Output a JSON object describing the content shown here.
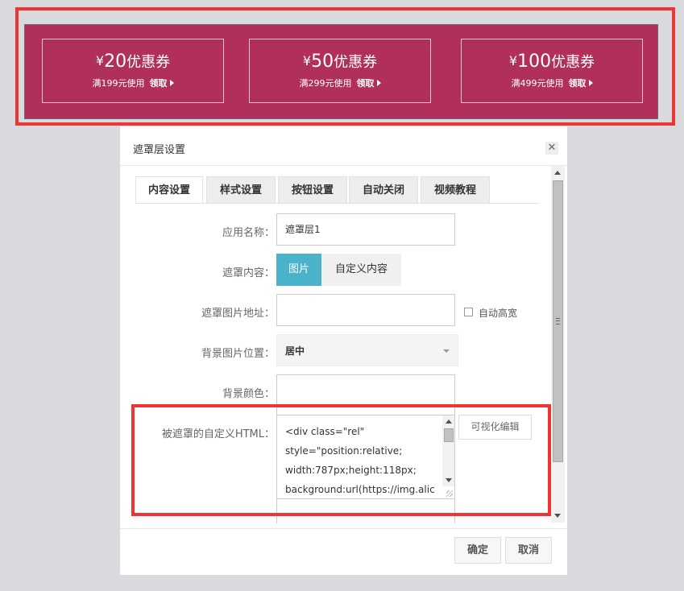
{
  "banner": {
    "coupons": [
      {
        "currency": "¥",
        "amount": "20",
        "title": "优惠券",
        "condition": "满199元使用",
        "claim": "领取"
      },
      {
        "currency": "¥",
        "amount": "50",
        "title": "优惠券",
        "condition": "满299元使用",
        "claim": "领取"
      },
      {
        "currency": "¥",
        "amount": "100",
        "title": "优惠券",
        "condition": "满499元使用",
        "claim": "领取"
      }
    ],
    "background_color": "#b0305a"
  },
  "dialog": {
    "title": "遮罩层设置",
    "close_symbol": "✕",
    "tabs": [
      {
        "label": "内容设置",
        "active": true
      },
      {
        "label": "样式设置",
        "active": false
      },
      {
        "label": "按钮设置",
        "active": false
      },
      {
        "label": "自动关闭",
        "active": false
      },
      {
        "label": "视频教程",
        "active": false
      }
    ],
    "fields": {
      "app_name": {
        "label": "应用名称：",
        "value": "遮罩层1"
      },
      "mask_content": {
        "label": "遮罩内容：",
        "options": [
          "图片",
          "自定义内容"
        ],
        "selected": "图片"
      },
      "mask_image_url": {
        "label": "遮罩图片地址：",
        "value": ""
      },
      "auto_height": {
        "label": "自动高宽",
        "checked": false
      },
      "bg_position": {
        "label": "背景图片位置：",
        "selected": "居中"
      },
      "bg_color": {
        "label": "背景颜色：",
        "value": ""
      },
      "custom_html": {
        "label": "被遮罩的自定义HTML：",
        "lines": [
          "<div class=\"rel\"",
          "style=\"position:relative;",
          "width:787px;height:118px;",
          "background:url(https://img.alic"
        ],
        "visual_edit_label": "可视化编辑"
      }
    },
    "footer": {
      "confirm_label": "确定",
      "cancel_label": "取消"
    }
  },
  "colors": {
    "accent": "#4bb3c9",
    "highlight_frame": "#ee3534"
  }
}
